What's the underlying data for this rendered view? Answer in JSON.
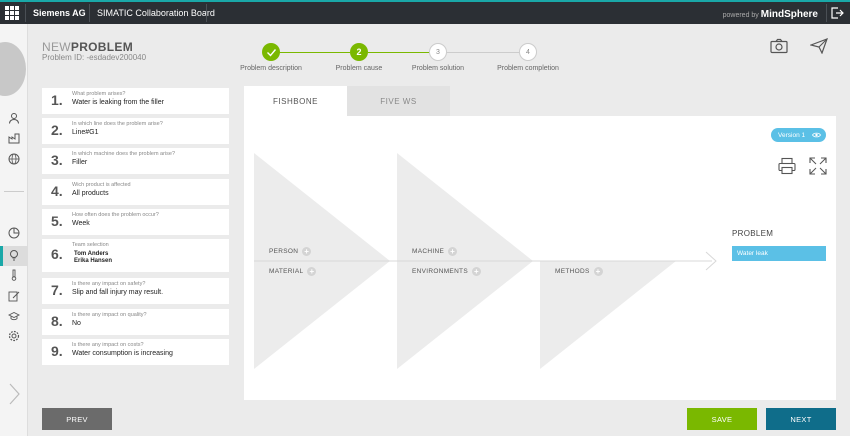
{
  "topbar": {
    "company": "Siemens AG",
    "app_title": "SIMATIC Collaboration Board",
    "powered_prefix": "powered by",
    "powered_brand": "MindSphere"
  },
  "header": {
    "title_prefix": "NEW",
    "title_main": "PROBLEM",
    "problem_id": "Problem ID: -esdadev200040"
  },
  "stepper": [
    {
      "num": "",
      "label": "Problem description",
      "state": "done"
    },
    {
      "num": "2",
      "label": "Problem cause",
      "state": "active"
    },
    {
      "num": "3",
      "label": "Problem solution",
      "state": "pending"
    },
    {
      "num": "4",
      "label": "Problem completion",
      "state": "pending"
    }
  ],
  "questions": [
    {
      "num": "1.",
      "label": "What problem arises?",
      "answer": "Water is leaking from the filler"
    },
    {
      "num": "2.",
      "label": "In which line does the problem arise?",
      "answer": "Line#G1"
    },
    {
      "num": "3.",
      "label": "In which machine does the problem arise?",
      "answer": "Filler"
    },
    {
      "num": "4.",
      "label": "Wich product is affected",
      "answer": "All products"
    },
    {
      "num": "5.",
      "label": "How often does the problem occur?",
      "answer": "Week"
    },
    {
      "num": "6.",
      "label": "Team selection",
      "team": [
        "Tom Anders",
        "Erika Hansen"
      ]
    },
    {
      "num": "7.",
      "label": "Is there any impact on safety?",
      "answer": "Slip and fall injury may result."
    },
    {
      "num": "8.",
      "label": "Is there any impact on quality?",
      "answer": "No"
    },
    {
      "num": "9.",
      "label": "Is there any impact on costs?",
      "answer": "Water consumption is increasing"
    }
  ],
  "tabs": {
    "fishbone": "FISHBONE",
    "five_ws": "FIVE WS"
  },
  "version_label": "Version 1",
  "fishbone": {
    "categories": {
      "person": "PERSON",
      "machine": "MACHINE",
      "material": "MATERIAL",
      "environments": "ENVIRONMENTS",
      "methods": "METHODS"
    },
    "problem_heading": "PROBLEM",
    "problem_value": "Water leak"
  },
  "buttons": {
    "prev": "PREV",
    "save": "SAVE",
    "next": "NEXT"
  },
  "colors": {
    "accent_green": "#7ab800",
    "accent_blue": "#5bc0e6",
    "next_blue": "#0f6d8a",
    "topbar_accent": "#1aa8a8"
  }
}
